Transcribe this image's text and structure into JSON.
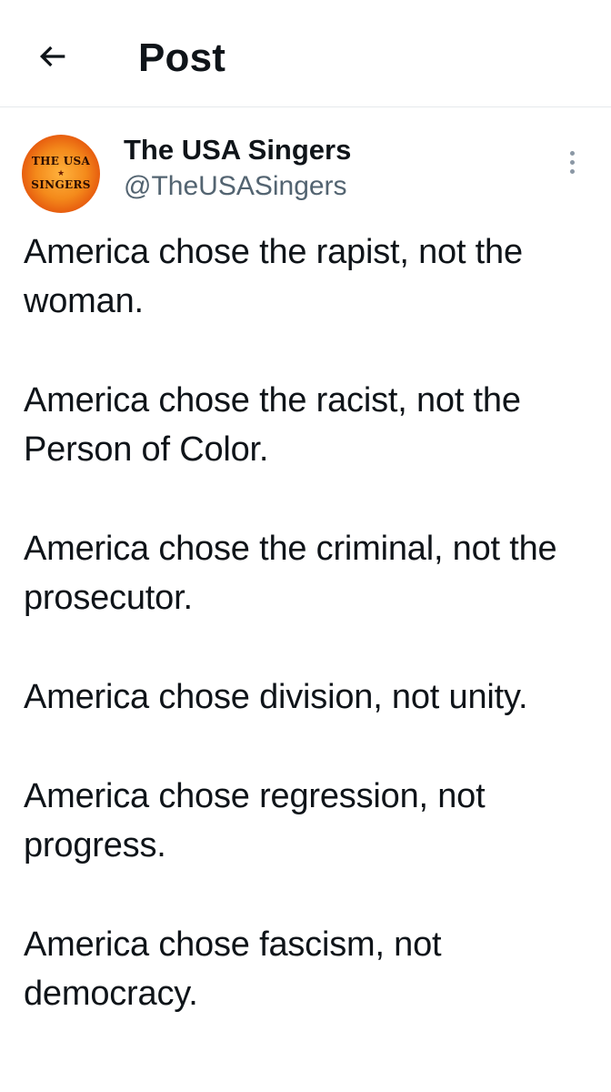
{
  "header": {
    "title": "Post",
    "back_icon": "arrow-left-icon"
  },
  "author": {
    "display_name": "The USA Singers",
    "handle": "@TheUSASingers",
    "avatar": {
      "line1": "THE USA",
      "line2": "SINGERS",
      "color": "#f48a1b"
    }
  },
  "post": {
    "paragraphs": [
      "America chose the rapist, not the woman.",
      "America chose the racist, not the Person of Color.",
      "America chose the criminal, not the prosecutor.",
      "America chose division, not unity.",
      "America chose regression, not progress.",
      "America chose fascism, not democracy."
    ]
  },
  "colors": {
    "text": "#0f1419",
    "secondary": "#536471",
    "divider": "#e6e9ec"
  }
}
